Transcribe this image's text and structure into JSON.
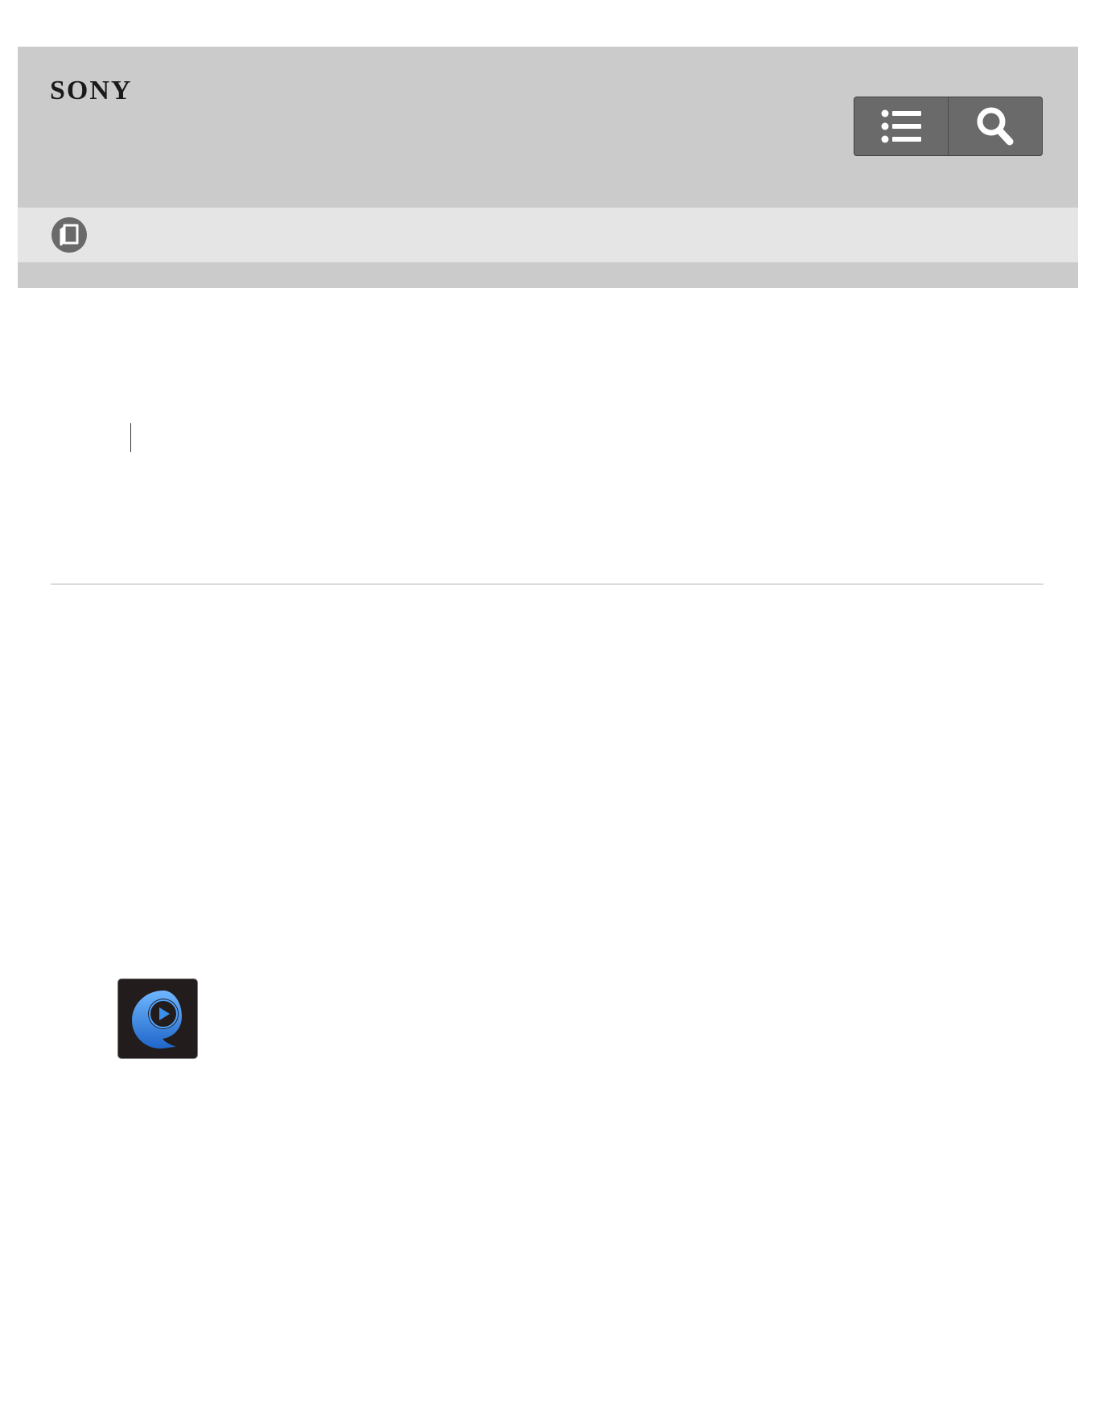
{
  "header": {
    "brand": "SONY",
    "toc_icon": "list-icon",
    "search_icon": "search-icon"
  },
  "subheader": {
    "book_icon": "book-icon"
  },
  "content": {
    "app_icon": "video-play-app-icon"
  },
  "colors": {
    "header_bg": "#cbcbcb",
    "subbar_bg": "#e5e5e5",
    "button_bg": "#6a6a6a",
    "app_icon_bg": "#231c1c",
    "app_icon_accent": "#3a8fe8"
  }
}
